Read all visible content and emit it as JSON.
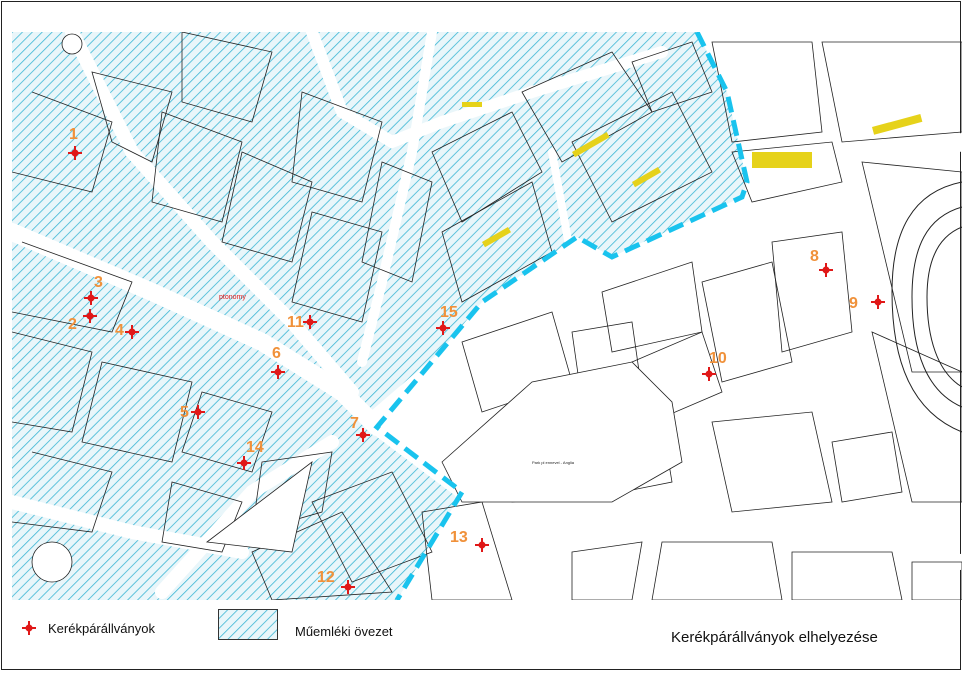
{
  "colors": {
    "heritage_hatch": "#3cb6d4",
    "boundary_dash": "#19c3ee",
    "marker": "#e01818",
    "label": "#f0913a",
    "building_line": "#222222",
    "yellow_mark": "#e6d21a"
  },
  "map": {
    "racks": [
      {
        "id": "1",
        "label": "1"
      },
      {
        "id": "2",
        "label": "2"
      },
      {
        "id": "3",
        "label": "3"
      },
      {
        "id": "4",
        "label": "4"
      },
      {
        "id": "5",
        "label": "5"
      },
      {
        "id": "6",
        "label": "6"
      },
      {
        "id": "7",
        "label": "7"
      },
      {
        "id": "8",
        "label": "8"
      },
      {
        "id": "9",
        "label": "9"
      },
      {
        "id": "10",
        "label": "10"
      },
      {
        "id": "11",
        "label": "11"
      },
      {
        "id": "12",
        "label": "12"
      },
      {
        "id": "13",
        "label": "13"
      },
      {
        "id": "14",
        "label": "14"
      },
      {
        "id": "15",
        "label": "15"
      }
    ],
    "park_label": "Park pl ennevel - Anglia"
  },
  "legend": {
    "rack_label": "Kerékpárállványok",
    "zone_label": "Műemléki övezet",
    "rack_icon": "bike-rack-marker-icon",
    "zone_icon": "hatched-zone-swatch-icon"
  },
  "title": "Kerékpárállványok elhelyezése"
}
